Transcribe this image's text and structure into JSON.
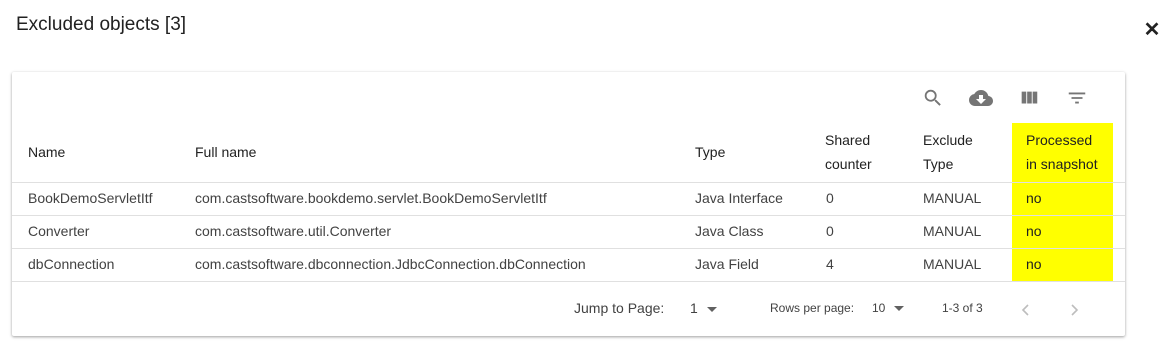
{
  "dialog": {
    "title": "Excluded objects [3]",
    "close_icon": "close-icon"
  },
  "toolbar": {
    "icons": [
      "search-icon",
      "cloud-download-icon",
      "view-column-icon",
      "filter-icon"
    ]
  },
  "table": {
    "highlight_color": "#ffff00",
    "headers": {
      "name": "Name",
      "full_name": "Full name",
      "type": "Type",
      "shared_counter_line1": "Shared",
      "shared_counter_line2": "counter",
      "exclude_type_line1": "Exclude",
      "exclude_type_line2": "Type",
      "processed_line1": "Processed",
      "processed_line2": "in snapshot"
    },
    "rows": [
      {
        "name": "BookDemoServletItf",
        "full_name": "com.castsoftware.bookdemo.servlet.BookDemoServletItf",
        "type": "Java Interface",
        "shared_counter": "0",
        "exclude_type": "MANUAL",
        "processed": "no"
      },
      {
        "name": "Converter",
        "full_name": "com.castsoftware.util.Converter",
        "type": "Java Class",
        "shared_counter": "0",
        "exclude_type": "MANUAL",
        "processed": "no"
      },
      {
        "name": "dbConnection",
        "full_name": "com.castsoftware.dbconnection.JdbcConnection.dbConnection",
        "type": "Java Field",
        "shared_counter": "4",
        "exclude_type": "MANUAL",
        "processed": "no"
      }
    ]
  },
  "pagination": {
    "jump_label": "Jump to Page:",
    "jump_value": "1",
    "rows_label": "Rows per page:",
    "rows_value": "10",
    "range": "1-3 of 3"
  }
}
